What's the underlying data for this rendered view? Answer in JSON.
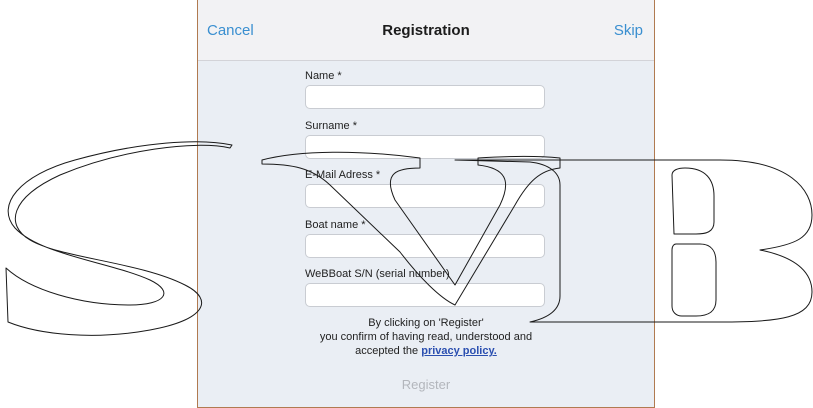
{
  "navbar": {
    "cancel_label": "Cancel",
    "title": "Registration",
    "skip_label": "Skip"
  },
  "form": {
    "fields": [
      {
        "label": "Name *",
        "value": ""
      },
      {
        "label": "Surname *",
        "value": ""
      },
      {
        "label": "E-Mail Adress *",
        "value": ""
      },
      {
        "label": "Boat name *",
        "value": ""
      },
      {
        "label": "WeBBoat S/N (serial number)",
        "value": ""
      }
    ]
  },
  "consent": {
    "line1": "By clicking on 'Register'",
    "line2": "you confirm of having read, understood and",
    "line3_prefix": "accepted the",
    "privacy_link": "privacy policy."
  },
  "register_label": "Register",
  "colors": {
    "accent": "#3a8fd0",
    "link": "#2b4fb0",
    "background": "#eaeef4",
    "disabled_text": "#b3b6bc"
  },
  "watermark": {
    "letters": [
      "S",
      "V",
      "B"
    ],
    "style": "outline"
  }
}
